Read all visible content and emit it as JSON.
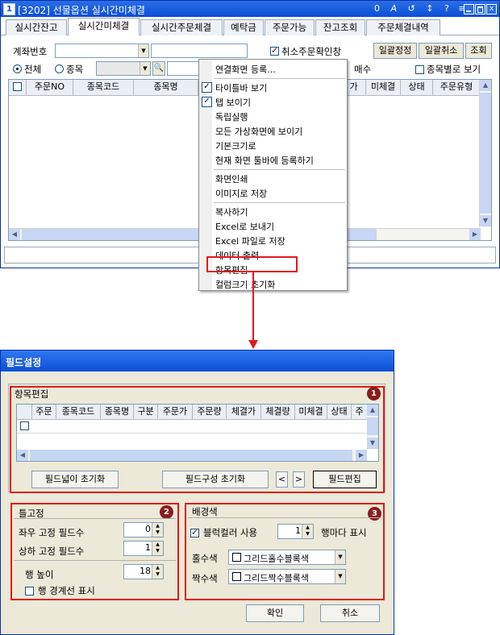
{
  "main_window": {
    "title": "[3202] 선물옵션 실시간미체결",
    "title_icons": [
      "0",
      "A",
      "↺",
      "↕",
      "?",
      "≡"
    ],
    "tabs": [
      "실시간잔고",
      "실시간미체결",
      "실시간주문체결",
      "예탁금",
      "주문가능",
      "잔고조회",
      "주문체결내역"
    ],
    "active_tab_index": 1,
    "account_label": "계좌번호",
    "cancel_confirm_label": "취소주문확인창",
    "btn_bulk_correct": "일괄정정",
    "btn_bulk_cancel": "일괄취소",
    "btn_query": "조회",
    "radio_all": "전체",
    "radio_item": "종목",
    "radio_buy": "매수",
    "by_item_view": "종목별로 보기",
    "grid_headers": [
      "주문NO",
      "종목코드",
      "종목명",
      "가",
      "미체결",
      "상태",
      "주문유형"
    ]
  },
  "context_menu": {
    "items": [
      {
        "label": "연결화면 등록...",
        "checked": false
      },
      {
        "label": "타이틀바 보기",
        "checked": true
      },
      {
        "label": "탭 보이기",
        "checked": true
      },
      {
        "label": "독립실행",
        "checked": false
      },
      {
        "label": "모든 가상화면에 보이기",
        "checked": false
      },
      {
        "label": "기본크기로",
        "checked": false
      },
      {
        "label": "현재 화면 툴바에 등록하기",
        "checked": false
      },
      {
        "label": "화면인쇄",
        "checked": false
      },
      {
        "label": "이미지로 저장",
        "checked": false
      },
      {
        "label": "복사하기",
        "checked": false
      },
      {
        "label": "Excel로 보내기",
        "checked": false
      },
      {
        "label": "Excel 파일로 저장",
        "checked": false
      },
      {
        "label": "데이터 출력",
        "checked": false
      },
      {
        "label": "항목편집",
        "checked": false
      },
      {
        "label": "컬럼크기 초기화",
        "checked": false
      }
    ],
    "highlighted": "항목편집"
  },
  "dialog": {
    "title": "필드설정",
    "section1_title": "항목편집",
    "section1_badge": "1",
    "grid_headers": [
      "주문",
      "종목코드",
      "종목명",
      "구분",
      "주문가",
      "주문량",
      "체결가",
      "체결량",
      "미체결",
      "상태",
      "주"
    ],
    "btn_reset_width": "필드넓이 초기화",
    "btn_reset_config": "필드구성 초기화",
    "btn_prev": "<",
    "btn_next": ">",
    "btn_field_edit": "필드편집",
    "section2_title": "틀고정",
    "section2_badge": "2",
    "lr_fixed_label": "좌우 고정 필드수",
    "lr_fixed_value": "0",
    "tb_fixed_label": "상하 고정 필드수",
    "tb_fixed_value": "1",
    "row_height_label": "행 높이",
    "row_height_value": "18",
    "row_border_label": "행 경계선 표시",
    "section3_title": "배경색",
    "section3_badge": "3",
    "block_color_label": "블럭컬러 사용",
    "block_color_value": "1",
    "per_row_label": "행마다 표시",
    "odd_color_label": "홀수색",
    "odd_color_value": "그리드홀수블록색",
    "even_color_label": "짝수색",
    "even_color_value": "그리드짝수블록색",
    "btn_ok": "확인",
    "btn_cancel": "취소"
  },
  "colors": {
    "xp_title": "#0a4fd6",
    "highlight": "#e0191b",
    "badge": "#8a1c1c"
  }
}
